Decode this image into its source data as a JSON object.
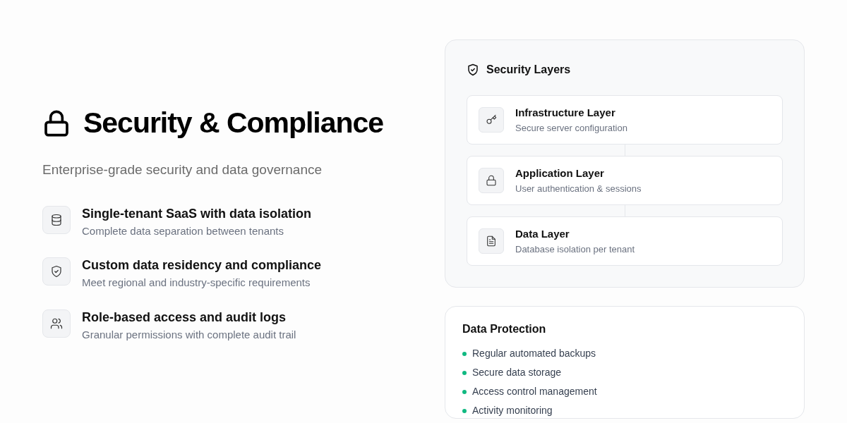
{
  "hero": {
    "title": "Security & Compliance",
    "subtitle": "Enterprise-grade security and data governance"
  },
  "features": [
    {
      "kind": "database",
      "title": "Single-tenant SaaS with data isolation",
      "description": "Complete data separation between tenants"
    },
    {
      "kind": "shield",
      "title": "Custom data residency and compliance",
      "description": "Meet regional and industry-specific requirements"
    },
    {
      "kind": "users",
      "title": "Role-based access and audit logs",
      "description": "Granular permissions with complete audit trail"
    }
  ],
  "security_layers": {
    "title": "Security Layers",
    "layers": [
      {
        "kind": "key",
        "title": "Infrastructure Layer",
        "description": "Secure server configuration"
      },
      {
        "kind": "lock",
        "title": "Application Layer",
        "description": "User authentication & sessions"
      },
      {
        "kind": "file",
        "title": "Data Layer",
        "description": "Database isolation per tenant"
      }
    ]
  },
  "data_protection": {
    "title": "Data Protection",
    "items": [
      "Regular automated backups",
      "Secure data storage",
      "Access control management",
      "Activity monitoring"
    ]
  }
}
